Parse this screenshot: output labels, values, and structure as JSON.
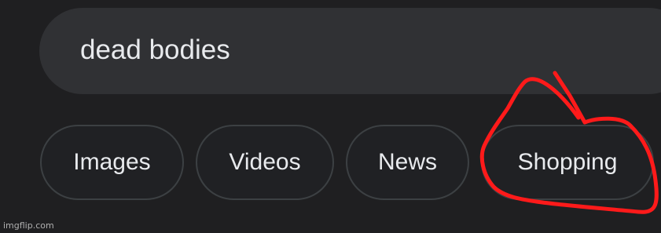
{
  "search": {
    "query": "dead bodies"
  },
  "filter_chips": [
    {
      "label": "Images"
    },
    {
      "label": "Videos"
    },
    {
      "label": "News"
    },
    {
      "label": "Shopping"
    }
  ],
  "annotation": {
    "color": "#ff1a1a",
    "target": "Shopping"
  },
  "watermark": "imgflip.com",
  "colors": {
    "background": "#202124",
    "search_bar": "#303134",
    "text": "#e8eaed",
    "chip_border": "#3c4043"
  }
}
